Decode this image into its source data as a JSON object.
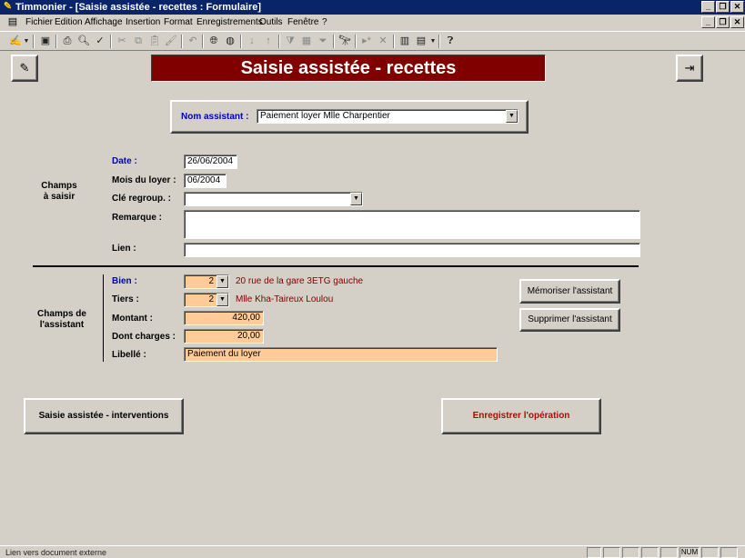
{
  "window": {
    "title": "Timmonier - [Saisie assistée - recettes : Formulaire]",
    "minimize_icon": "minimize-icon",
    "restore_icon": "restore-icon",
    "close_icon": "close-icon"
  },
  "menu": {
    "items": [
      "Fichier",
      "Edition",
      "Affichage",
      "Insertion",
      "Format",
      "Enregistrements",
      "Outils",
      "Fenêtre",
      "?"
    ]
  },
  "form": {
    "title": "Saisie assistée - recettes",
    "help_icon": "help-icon",
    "exit_icon": "exit-door-icon",
    "assistant_label": "Nom assistant :",
    "assistant_value": "Paiement loyer Mlle Charpentier",
    "section_champs": "Champs\nà saisir",
    "section_assistant": "Champs de\nl'assistant",
    "date_label": "Date :",
    "date_value": "26/06/2004",
    "mois_label": "Mois du loyer :",
    "mois_value": "06/2004",
    "cle_label": "Clé regroup. :",
    "cle_value": "",
    "remarque_label": "Remarque :",
    "remarque_value": "",
    "lien_label": "Lien :",
    "lien_value": "",
    "bien_label": "Bien :",
    "bien_value": "2",
    "bien_text": "20 rue de la gare 3ETG gauche",
    "tiers_label": "Tiers :",
    "tiers_value": "2",
    "tiers_text": "Mlle Kha-Taireux Loulou",
    "montant_label": "Montant :",
    "montant_value": "420,00",
    "charges_label": "Dont charges :",
    "charges_value": "20,00",
    "libelle_label": "Libellé :",
    "libelle_value": "Paiement du loyer",
    "memoriser_button": "Mémoriser l'assistant",
    "supprimer_button": "Supprimer l'assistant",
    "interventions_button": "Saisie assistée - interventions",
    "enregistrer_button": "Enregistrer l'opération"
  },
  "status": {
    "text": "Lien vers document externe",
    "num": "NUM"
  },
  "colors": {
    "title_bg": "#800000",
    "label_blue": "#0000c0",
    "orange_field": "#ffcc99",
    "enregistrer_text": "#c00000"
  }
}
